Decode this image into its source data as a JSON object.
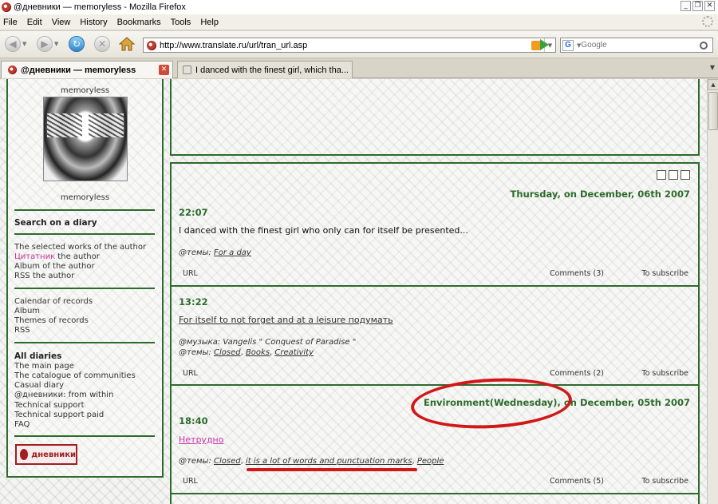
{
  "window": {
    "title": "@дневники — memoryless - Mozilla Firefox"
  },
  "menu": [
    "File",
    "Edit",
    "View",
    "History",
    "Bookmarks",
    "Tools",
    "Help"
  ],
  "nav": {
    "url": "http://www.translate.ru/url/tran_url.asp",
    "search_placeholder": "Google"
  },
  "tabs": [
    {
      "label": "@дневники — memoryless",
      "active": true
    },
    {
      "label": "I danced with the finest girl, which tha...",
      "active": false
    }
  ],
  "sidebar": {
    "username_top": "memoryless",
    "username_bottom": "memoryless",
    "search_heading": "Search on a diary",
    "group1": {
      "item1": "The selected works of the author",
      "item2_pink": "Цитатник",
      "item2_rest": " the author",
      "item3": "Album of the author",
      "item4": "RSS the author"
    },
    "group2": [
      "Calendar of records",
      "Album",
      "Themes of records",
      "RSS"
    ],
    "group3_heading": "All diaries",
    "group3": [
      "The main page",
      "The catalogue of communities",
      "Casual diary",
      "@дневники: from within",
      "Technical support",
      "Technical support paid",
      "FAQ"
    ],
    "banner": "дневники"
  },
  "posts": {
    "date1": "Thursday, on December, 06th 2007",
    "p1": {
      "time": "22:07",
      "text": "I danced with the finest girl who only can for itself be presented...",
      "themes_label": "@темы:",
      "themes": [
        "For a day"
      ],
      "url": "URL",
      "comments": "Comments (3)",
      "subscribe": "To subscribe"
    },
    "p2": {
      "time": "13:22",
      "title": "For itself to not forget and at a leisure подумать",
      "music_label": "@музыка:",
      "music": "Vangelis \" Conquest of Paradise \"",
      "themes_label": "@темы:",
      "themes": [
        "Closed",
        "Books",
        "Creativity"
      ],
      "url": "URL",
      "comments": "Comments (2)",
      "subscribe": "To subscribe"
    },
    "date2_part1": "Environment(Wednesday),",
    "date2_part2": " on December, 05th 2007",
    "p3": {
      "time": "18:40",
      "title": "Нетрудно",
      "themes_label": "@темы:",
      "themes": [
        "Closed",
        "it is a lot of words and punctuation marks",
        "People"
      ],
      "url": "URL",
      "comments": "Comments (5)",
      "subscribe": "To subscribe"
    }
  },
  "colors": {
    "accent": "#2d6b2d",
    "annotation": "#d01818",
    "pink_link": "#cc3399"
  }
}
